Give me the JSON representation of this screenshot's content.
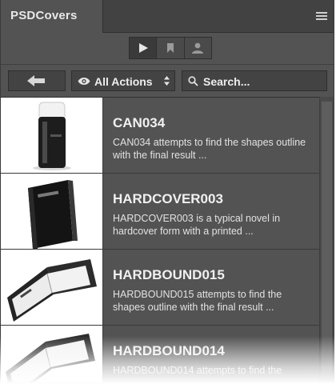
{
  "tab": {
    "title": "PSDCovers"
  },
  "toolbar": {
    "modes": [
      {
        "icon": "play-icon",
        "active": true
      },
      {
        "icon": "bookmark-icon",
        "active": false
      },
      {
        "icon": "user-icon",
        "active": false
      }
    ],
    "back_icon": "arrow-left-icon",
    "actions_label": "All Actions",
    "search_label": "Search..."
  },
  "items": [
    {
      "title": "CAN034",
      "description": "CAN034 attempts to find the shapes outline with the final result ..."
    },
    {
      "title": "HARDCOVER003",
      "description": "HARDCOVER003 is a typical novel in hardcover form with a printed ..."
    },
    {
      "title": "HARDBOUND015",
      "description": "HARDBOUND015 attempts to find the shapes outline with the final result ..."
    },
    {
      "title": "HARDBOUND014",
      "description": "HARDBOUND014 attempts to find the"
    }
  ],
  "colors": {
    "panel": "#535353",
    "tabbar": "#424242",
    "text": "#f0f0f0"
  }
}
